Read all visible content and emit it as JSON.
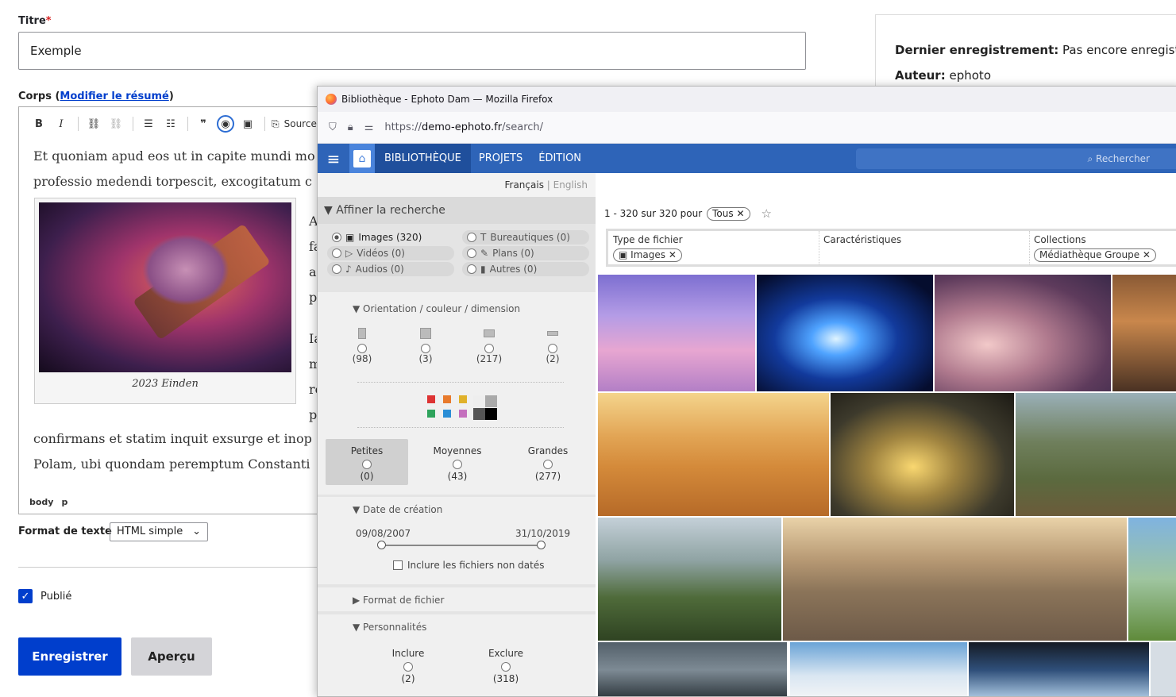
{
  "form": {
    "titre_label": "Titre",
    "titre_required": "*",
    "titre_value": "Exemple",
    "corps_label": "Corps (",
    "corps_link": "Modifier le résumé",
    "corps_close": ")",
    "source_label": "Source",
    "body_line1": "Et quoniam apud eos ut in capite mundi mo",
    "body_line2": "professio medendi torpescit, excogitatum c",
    "body_line3": "confirmans et statim inquit exsurge et inop",
    "body_line4": "Polam, ubi quondam peremptum Constanti",
    "side_letters": [
      "A",
      "fa",
      "ac",
      "pi",
      "Ia",
      "m",
      "re",
      "pe"
    ],
    "figure_caption": "2023 Einden",
    "status_path": [
      "body",
      "p"
    ],
    "format_label": "Format de texte",
    "format_value": "HTML simple",
    "publie_label": "Publié",
    "save_button": "Enregistrer",
    "preview_button": "Aperçu"
  },
  "meta": {
    "last_save_label": "Dernier enregistrement:",
    "last_save_value": "Pas encore enregistré",
    "author_label": "Auteur:",
    "author_value": "ephoto"
  },
  "firefox": {
    "window_title": "Bibliothèque - Ephoto Dam — Mozilla Firefox",
    "url_prefix": "https://",
    "url_domain": "demo-ephoto.fr",
    "url_path": "/search/"
  },
  "app": {
    "nav_tabs": [
      "BIBLIOTHÈQUE",
      "PROJETS",
      "ÉDITION"
    ],
    "search_placeholder": "Rechercher",
    "lang_active": "Français",
    "lang_sep": "|",
    "lang_other": "English",
    "refine_title": "Affiner la recherche",
    "file_types": [
      {
        "label": "Images (320)",
        "selected": true
      },
      {
        "label": "Bureautiques (0)",
        "selected": false
      },
      {
        "label": "Vidéos (0)",
        "selected": false
      },
      {
        "label": "Plans (0)",
        "selected": false
      },
      {
        "label": "Audios (0)",
        "selected": false
      },
      {
        "label": "Autres (0)",
        "selected": false
      }
    ],
    "orientation_title": "Orientation / couleur / dimension",
    "orientation_counts": [
      "(98)",
      "(3)",
      "(217)",
      "(2)"
    ],
    "sizes": [
      {
        "label": "Petites",
        "count": "(0)"
      },
      {
        "label": "Moyennes",
        "count": "(43)"
      },
      {
        "label": "Grandes",
        "count": "(277)"
      }
    ],
    "date_title": "Date de création",
    "date_start": "09/08/2007",
    "date_end": "31/10/2019",
    "undated_label": "Inclure les fichiers non datés",
    "file_format_title": "Format de fichier",
    "people_title": "Personnalités",
    "people_include": "Inclure",
    "people_include_count": "(2)",
    "people_exclude": "Exclure",
    "people_exclude_count": "(318)",
    "results_count": "1 - 320 sur 320 pour",
    "results_chip": "Tous",
    "facet_type_title": "Type de fichier",
    "facet_type_chip": "Images",
    "facet_char_title": "Caractéristiques",
    "facet_coll_title": "Collections",
    "facet_coll_chip": "Médiathèque Groupe"
  },
  "colors": {
    "drupal_blue": "#003ecc",
    "nav_blue": "#2e64b8"
  }
}
